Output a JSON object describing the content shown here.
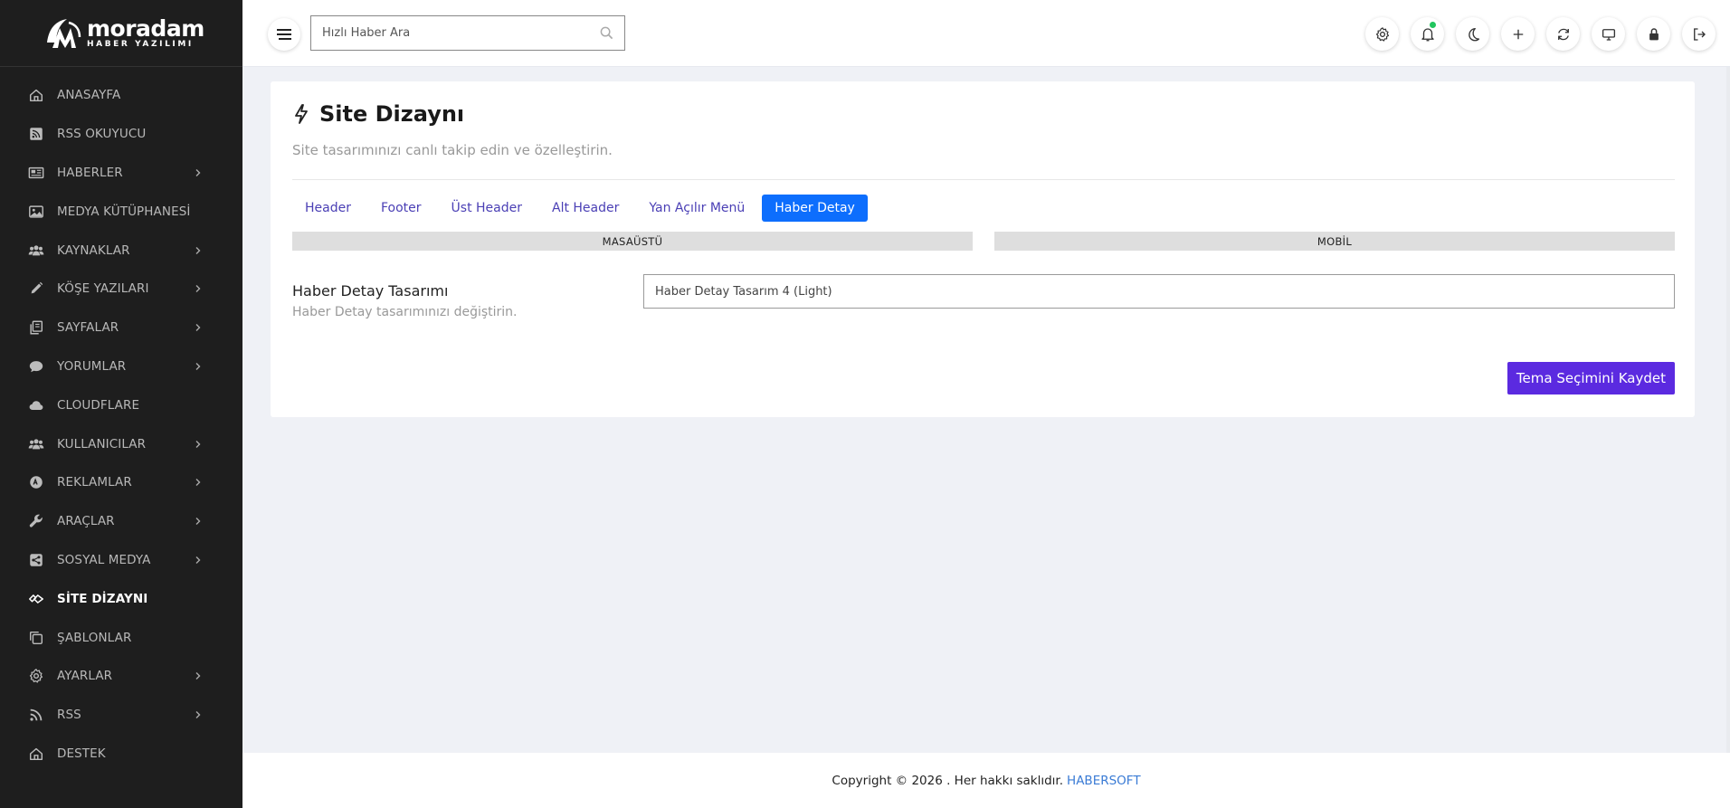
{
  "brand": {
    "name": "moradam",
    "sub": "HABER YAZILIMI"
  },
  "sidebar": {
    "items": [
      {
        "label": "ANASAYFA",
        "icon": "home-icon",
        "chevron": false,
        "active": false
      },
      {
        "label": "RSS OKUYUCU",
        "icon": "rss-square-icon",
        "chevron": false,
        "active": false
      },
      {
        "label": "HABERLER",
        "icon": "newspaper-icon",
        "chevron": true,
        "active": false
      },
      {
        "label": "MEDYA KÜTÜPHANESİ",
        "icon": "image-icon",
        "chevron": false,
        "active": false
      },
      {
        "label": "KAYNAKLAR",
        "icon": "users-icon",
        "chevron": true,
        "active": false
      },
      {
        "label": "KÖŞE YAZILARI",
        "icon": "pen-icon",
        "chevron": true,
        "active": false
      },
      {
        "label": "SAYFALAR",
        "icon": "pages-icon",
        "chevron": true,
        "active": false
      },
      {
        "label": "YORUMLAR",
        "icon": "comment-icon",
        "chevron": true,
        "active": false
      },
      {
        "label": "CLOUDFLARE",
        "icon": "cloud-icon",
        "chevron": false,
        "active": false
      },
      {
        "label": "KULLANICILAR",
        "icon": "users-icon",
        "chevron": true,
        "active": false
      },
      {
        "label": "REKLAMLAR",
        "icon": "ad-icon",
        "chevron": true,
        "active": false
      },
      {
        "label": "ARAÇLAR",
        "icon": "wrench-icon",
        "chevron": true,
        "active": false
      },
      {
        "label": "SOSYAL MEDYA",
        "icon": "share-icon",
        "chevron": true,
        "active": false
      },
      {
        "label": "SİTE DİZAYNI",
        "icon": "design-icon",
        "chevron": false,
        "active": true
      },
      {
        "label": "ŞABLONLAR",
        "icon": "templates-icon",
        "chevron": false,
        "active": false
      },
      {
        "label": "AYARLAR",
        "icon": "gear-icon",
        "chevron": true,
        "active": false
      },
      {
        "label": "RSS",
        "icon": "rss-icon",
        "chevron": true,
        "active": false
      },
      {
        "label": "DESTEK",
        "icon": "home-icon",
        "chevron": false,
        "active": false
      }
    ]
  },
  "topbar": {
    "search_placeholder": "Hızlı Haber Ara",
    "icons": [
      "settings-icon",
      "bell-icon",
      "moon-icon",
      "plus-icon",
      "refresh-icon",
      "monitor-icon",
      "lock-icon",
      "logout-icon"
    ]
  },
  "page": {
    "title": "Site Dizaynı",
    "subtitle": "Site tasarımınızı canlı takip edin ve özelleştirin.",
    "tabs": [
      {
        "label": "Header",
        "active": false
      },
      {
        "label": "Footer",
        "active": false
      },
      {
        "label": "Üst Header",
        "active": false
      },
      {
        "label": "Alt Header",
        "active": false
      },
      {
        "label": "Yan Açılır Menü",
        "active": false
      },
      {
        "label": "Haber Detay",
        "active": true
      }
    ],
    "device_desktop": "MASAÜSTÜ",
    "device_mobile": "MOBİL",
    "field_label": "Haber Detay Tasarımı",
    "field_help": "Haber Detay tasarımınızı değiştirin.",
    "field_value": "Haber Detay Tasarım 4 (Light)",
    "save_label": "Tema Seçimini Kaydet"
  },
  "footer": {
    "text": "Copyright © 2026 . Her hakkı saklıdır.",
    "brand": "HABERSOFT"
  },
  "colors": {
    "sidebar_bg": "#1e1e1e",
    "active_tab": "#0d6efd",
    "save_button": "#5b2ae0",
    "tab_text": "#4a3fb5",
    "notification_dot": "#22c55e",
    "footer_link": "#3a7bd5"
  }
}
